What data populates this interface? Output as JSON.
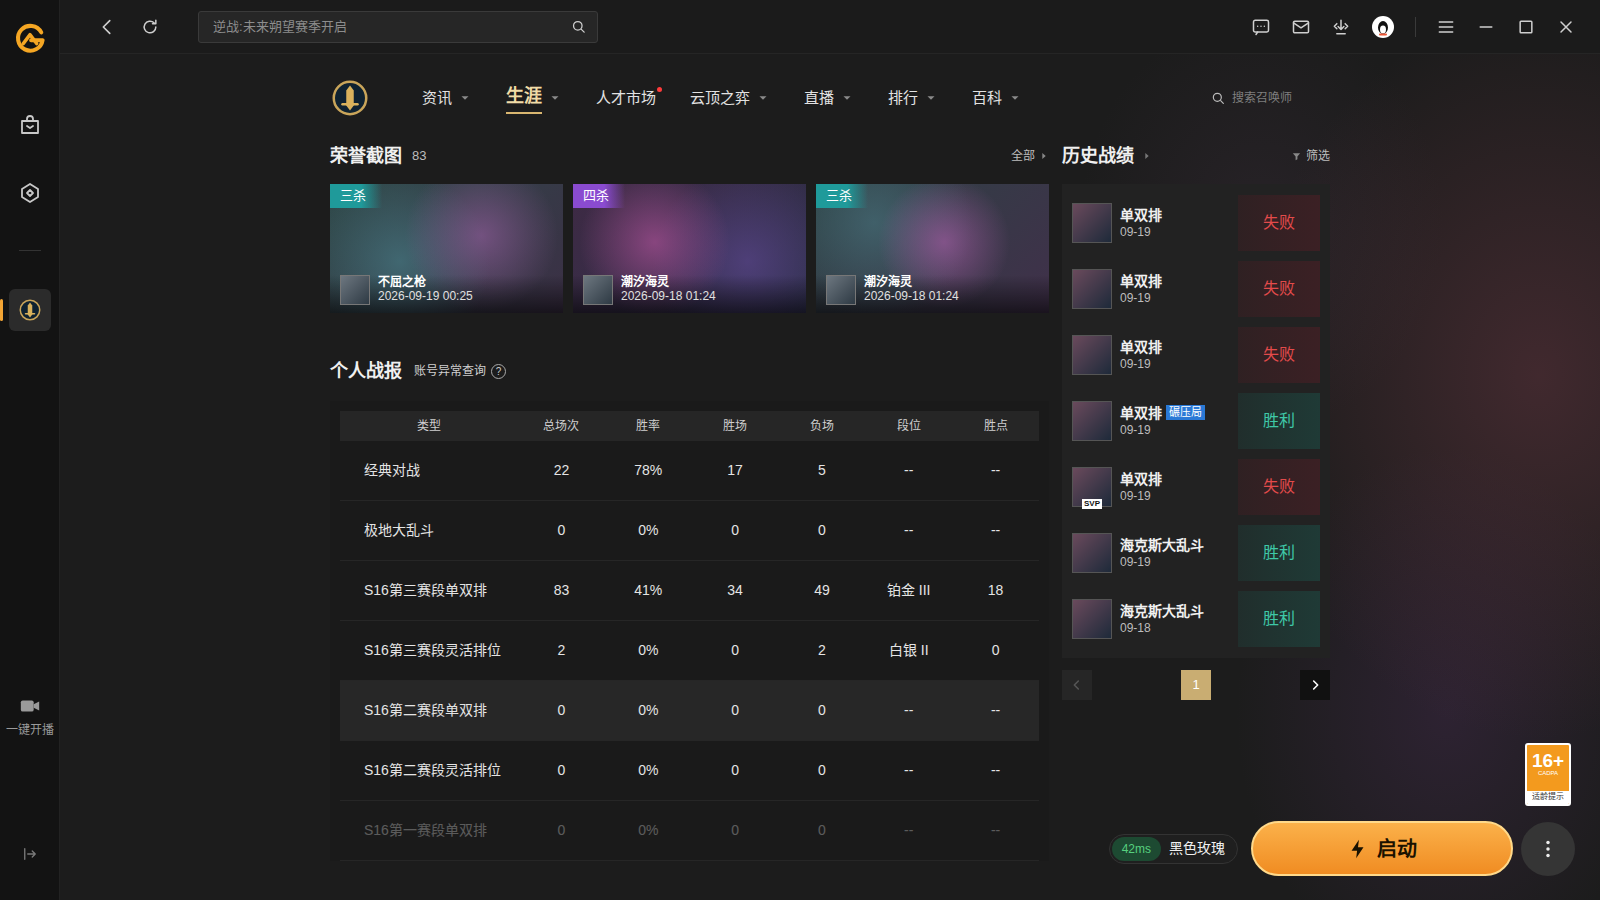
{
  "window": {
    "search": {
      "placeholder": "逆战:未来朔望赛季开启"
    }
  },
  "sidebar": {
    "items": [
      {
        "selected": false
      },
      {
        "selected": false
      },
      {
        "selected": true
      }
    ],
    "live": {
      "label": "一键开播"
    }
  },
  "nav": {
    "tabs": [
      {
        "label": "资讯",
        "has_menu": true,
        "dot": false,
        "selected": false
      },
      {
        "label": "生涯",
        "has_menu": true,
        "dot": false,
        "selected": true
      },
      {
        "label": "人才市场",
        "has_menu": false,
        "dot": true,
        "selected": false
      },
      {
        "label": "云顶之弈",
        "has_menu": true,
        "dot": false,
        "selected": false
      },
      {
        "label": "直播",
        "has_menu": true,
        "dot": false,
        "selected": false
      },
      {
        "label": "排行",
        "has_menu": true,
        "dot": false,
        "selected": false
      },
      {
        "label": "百科",
        "has_menu": true,
        "dot": false,
        "selected": false
      }
    ],
    "search": {
      "placeholder": "搜索召唤师"
    }
  },
  "honor": {
    "title": "荣誉截图",
    "count": "83",
    "more": "全部",
    "shots": [
      {
        "tag": "三杀",
        "color": "#1f9a9a",
        "champion": "不屈之枪",
        "time": "2026-09-19 00:25"
      },
      {
        "tag": "四杀",
        "color": "#8a4bd0",
        "champion": "潮汐海灵",
        "time": "2026-09-18 01:24"
      },
      {
        "tag": "三杀",
        "color": "#1f9a9a",
        "champion": "潮汐海灵",
        "time": "2026-09-18 01:24"
      }
    ]
  },
  "report": {
    "title": "个人战报",
    "link": "账号异常查询",
    "help": "?",
    "columns": [
      "类型",
      "总场次",
      "胜率",
      "胜场",
      "负场",
      "段位",
      "胜点"
    ],
    "rows": [
      {
        "cells": [
          "经典对战",
          "22",
          "78%",
          "17",
          "5",
          "--",
          "--"
        ],
        "highlighted": false,
        "faded": false
      },
      {
        "cells": [
          "极地大乱斗",
          "0",
          "0%",
          "0",
          "0",
          "--",
          "--"
        ],
        "highlighted": false,
        "faded": false
      },
      {
        "cells": [
          "S16第三赛段单双排",
          "83",
          "41%",
          "34",
          "49",
          "铂金 III",
          "18"
        ],
        "highlighted": false,
        "faded": false
      },
      {
        "cells": [
          "S16第三赛段灵活排位",
          "2",
          "0%",
          "0",
          "2",
          "白银 II",
          "0"
        ],
        "highlighted": false,
        "faded": false
      },
      {
        "cells": [
          "S16第二赛段单双排",
          "0",
          "0%",
          "0",
          "0",
          "--",
          "--"
        ],
        "highlighted": true,
        "faded": false
      },
      {
        "cells": [
          "S16第二赛段灵活排位",
          "0",
          "0%",
          "0",
          "0",
          "--",
          "--"
        ],
        "highlighted": false,
        "faded": false
      },
      {
        "cells": [
          "S16第一赛段单双排",
          "0",
          "0%",
          "0",
          "0",
          "--",
          "--"
        ],
        "highlighted": false,
        "faded": true
      }
    ]
  },
  "history": {
    "title": "历史战绩",
    "filter": "筛选",
    "matches": [
      {
        "mode": "单双排",
        "date": "09-19",
        "result": "失败",
        "win": false
      },
      {
        "mode": "单双排",
        "date": "09-19",
        "result": "失败",
        "win": false
      },
      {
        "mode": "单双排",
        "date": "09-19",
        "result": "失败",
        "win": false
      },
      {
        "mode": "单双排",
        "badge": "碾压局",
        "date": "09-19",
        "result": "胜利",
        "win": true
      },
      {
        "mode": "单双排",
        "avatar_tag": "SVP",
        "date": "09-19",
        "result": "失败",
        "win": false
      },
      {
        "mode": "海克斯大乱斗",
        "date": "09-19",
        "result": "胜利",
        "win": true
      },
      {
        "mode": "海克斯大乱斗",
        "date": "09-18",
        "result": "胜利",
        "win": true
      }
    ],
    "pagination": {
      "prev_disabled": true,
      "next_disabled": false,
      "pages": [
        {
          "label": "1",
          "selected": true
        }
      ]
    }
  },
  "launcher": {
    "ping": "42ms",
    "server": "黑色玫瑰",
    "button": "启动"
  },
  "age_rating": {
    "rating": "16+",
    "org": "CADPA",
    "label": "适龄提示"
  }
}
